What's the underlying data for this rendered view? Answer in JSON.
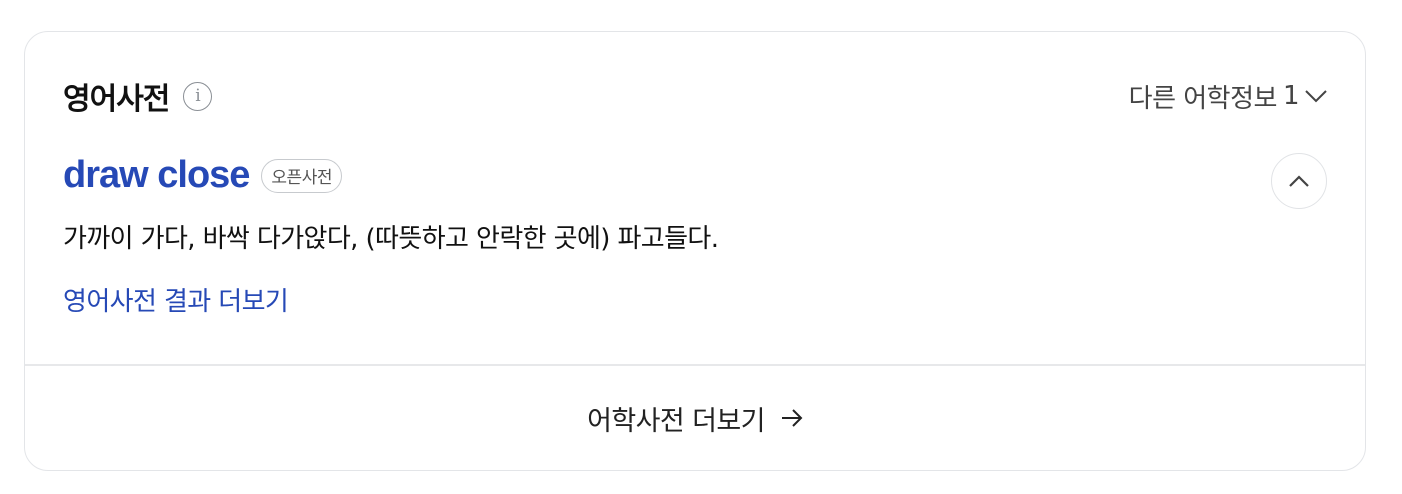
{
  "section": {
    "title": "영어사전",
    "info_icon": "info-icon",
    "other_info_label": "다른 어학정보",
    "other_info_count": "1",
    "other_info_icon": "chevron-down-icon"
  },
  "entry": {
    "word": "draw close",
    "badge": "오픈사전",
    "collapse_icon": "chevron-up-icon",
    "definition": "가까이 가다, 바싹 다가앉다, (따뜻하고 안락한 곳에) 파고들다.",
    "more_results_label": "영어사전 결과 더보기"
  },
  "footer": {
    "label": "어학사전 더보기",
    "icon": "arrow-right-icon"
  },
  "colors": {
    "accent": "#2649b6",
    "border": "#e3e5e8",
    "text": "#222222"
  }
}
